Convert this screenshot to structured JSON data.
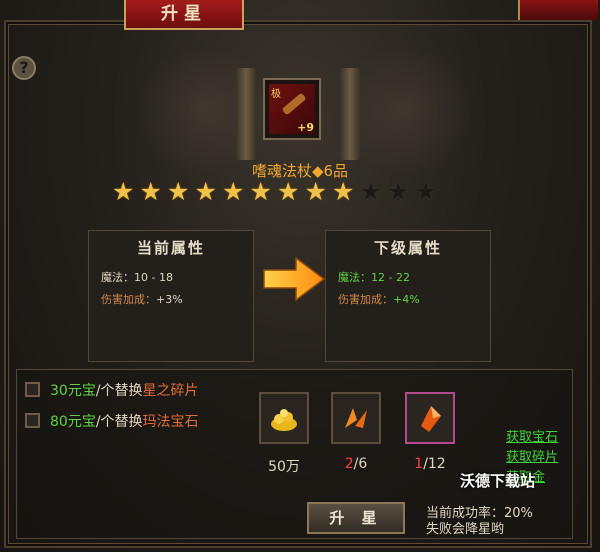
{
  "window": {
    "title": "升星"
  },
  "item": {
    "grade_badge": "极",
    "enhance_level": "+9",
    "name": "嗜魂法杖◆6品",
    "stars_total": 12,
    "stars_lit": 9
  },
  "current_attrs": {
    "heading": "当前属性",
    "magic": "魔法：10 - 18",
    "damage_bonus_label": "伤害加成：",
    "damage_bonus_value": "+3%"
  },
  "next_attrs": {
    "heading": "下级属性",
    "magic": "魔法：12 - 22",
    "damage_bonus_label": "伤害加成：",
    "damage_bonus_value": "+4%"
  },
  "options": [
    {
      "amount": "30元宝",
      "mid": "/个替换",
      "target": "星之碎片",
      "checked": false
    },
    {
      "amount": "80元宝",
      "mid": "/个替换",
      "target": "玛法宝石",
      "checked": false
    }
  ],
  "materials": {
    "gold": {
      "icon": "gold-pile-icon",
      "qty": "50万"
    },
    "shard": {
      "icon": "star-shard-icon",
      "have": "2",
      "need": "/6"
    },
    "gem": {
      "icon": "mafa-gem-icon",
      "have": "1",
      "need": "/12"
    }
  },
  "links": [
    "获取宝石",
    "获取碎片",
    "获取金"
  ],
  "upgrade_button": "升 星",
  "success_rate": "当前成功率：20%",
  "failure_note": "失败会降星哟",
  "watermark": "沃德下载站",
  "colors": {
    "accent_gold": "#f0c24a",
    "green": "#5fd442",
    "red": "#ff4040",
    "title_red": "#a41c1c"
  }
}
